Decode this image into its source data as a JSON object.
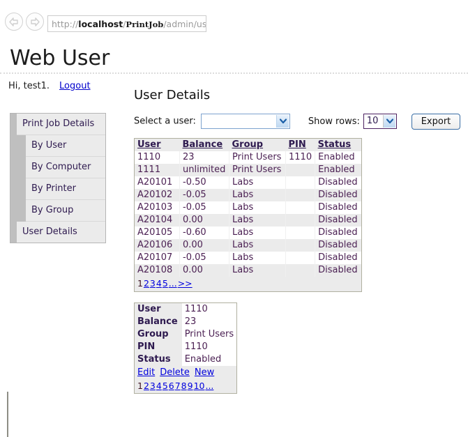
{
  "browser": {
    "back_icon": "back-arrow-icon",
    "forward_icon": "forward-arrow-icon",
    "url": {
      "scheme": "http://",
      "host": "localhost",
      "sep": "/",
      "app": "PrintJob",
      "path": "/admin/userinfo.aspx"
    }
  },
  "header": {
    "title": "Web User",
    "greeting": "Hi, test1.",
    "logout_label": "Logout"
  },
  "sidebar": {
    "items": [
      {
        "label": "Print Job Details",
        "level": "top"
      },
      {
        "label": "By User",
        "level": "sub"
      },
      {
        "label": "By Computer",
        "level": "sub"
      },
      {
        "label": "By Printer",
        "level": "sub"
      },
      {
        "label": "By Group",
        "level": "sub"
      },
      {
        "label": "User Details",
        "level": "top"
      }
    ]
  },
  "main": {
    "heading": "User Details",
    "select_user_label": "Select a user:",
    "select_user_value": "",
    "show_rows_label": "Show rows:",
    "show_rows_value": "10",
    "export_label": "Export",
    "dropdown_icon": "chevron-down-icon"
  },
  "grid": {
    "columns": [
      "User",
      "Balance",
      "Group",
      "PIN",
      "Status"
    ],
    "rows": [
      {
        "user": "1110",
        "balance": "23",
        "group": "Print Users",
        "pin": "1110",
        "status": "Enabled"
      },
      {
        "user": "1111",
        "balance": "unlimited",
        "group": "Print Users",
        "pin": "",
        "status": "Enabled"
      },
      {
        "user": "A20101",
        "balance": "-0.50",
        "group": "Labs",
        "pin": "",
        "status": "Disabled"
      },
      {
        "user": "A20102",
        "balance": "-0.05",
        "group": "Labs",
        "pin": "",
        "status": "Disabled"
      },
      {
        "user": "A20103",
        "balance": "-0.05",
        "group": "Labs",
        "pin": "",
        "status": "Disabled"
      },
      {
        "user": "A20104",
        "balance": "0.00",
        "group": "Labs",
        "pin": "",
        "status": "Disabled"
      },
      {
        "user": "A20105",
        "balance": "-0.60",
        "group": "Labs",
        "pin": "",
        "status": "Disabled"
      },
      {
        "user": "A20106",
        "balance": "0.00",
        "group": "Labs",
        "pin": "",
        "status": "Disabled"
      },
      {
        "user": "A20107",
        "balance": "-0.05",
        "group": "Labs",
        "pin": "",
        "status": "Disabled"
      },
      {
        "user": "A20108",
        "balance": "0.00",
        "group": "Labs",
        "pin": "",
        "status": "Disabled"
      }
    ],
    "pager": {
      "current": "1",
      "links": [
        "2",
        "3",
        "4",
        "5",
        "...",
        ">>"
      ]
    }
  },
  "detail": {
    "fields": [
      {
        "label": "User",
        "value": "1110"
      },
      {
        "label": "Balance",
        "value": "23"
      },
      {
        "label": "Group",
        "value": "Print Users"
      },
      {
        "label": "PIN",
        "value": "1110"
      },
      {
        "label": "Status",
        "value": "Enabled"
      }
    ],
    "actions": [
      "Edit",
      "Delete",
      "New"
    ],
    "pager": {
      "current": "1",
      "links": [
        "2",
        "3",
        "4",
        "5",
        "6",
        "7",
        "8",
        "9",
        "10",
        "..."
      ]
    }
  },
  "colors": {
    "link": "#0000dd",
    "table_header_bg": "#ebebeb",
    "table_row_alt_bg": "#ebebeb",
    "nav_item_bg": "#ebebeb",
    "nav_rail": "#bfbfbf",
    "text_purple": "#4a1f52",
    "export_border": "#3a6ea5"
  }
}
